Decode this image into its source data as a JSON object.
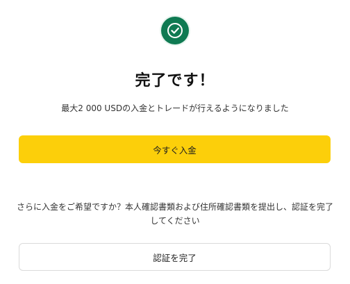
{
  "success": {
    "icon": "check-circle-icon",
    "color": "#0f7a52"
  },
  "title": "完了です！",
  "subtitle": "最大2 000 USDの入金とトレードが行えるようになりました",
  "primary_button": {
    "label": "今すぐ入金",
    "color": "#fccf0a"
  },
  "notice": "さらに入金をご希望ですか？本人確認書類および住所確認書類を提出し、認証を完了してください",
  "secondary_button": {
    "label": "認証を完了"
  }
}
